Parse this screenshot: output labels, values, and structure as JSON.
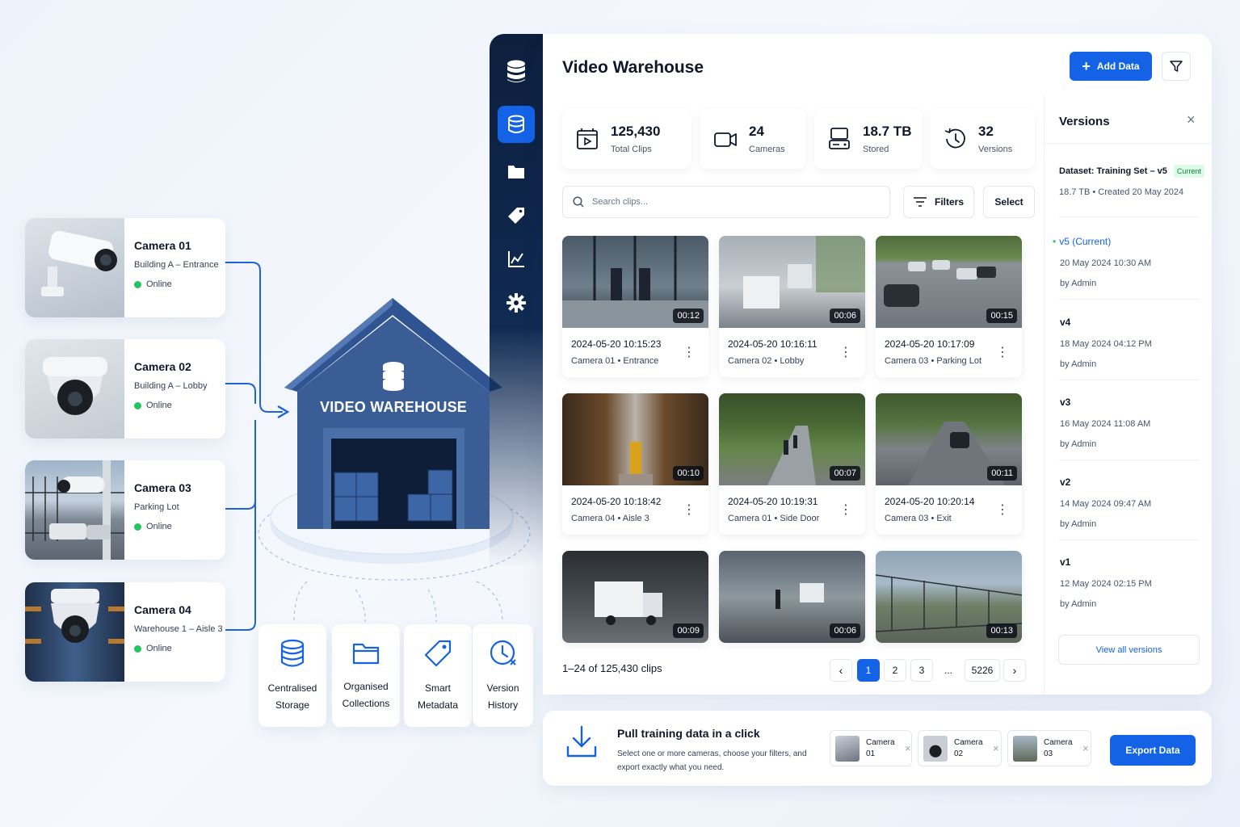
{
  "cameras": [
    {
      "name": "Camera 01",
      "location": "Building A – Entrance",
      "status": "Online"
    },
    {
      "name": "Camera 02",
      "location": "Building A – Lobby",
      "status": "Online"
    },
    {
      "name": "Camera 03",
      "location": "Parking Lot",
      "status": "Online"
    },
    {
      "name": "Camera 04",
      "location": "Warehouse 1 – Aisle 3",
      "status": "Online"
    }
  ],
  "warehouse_label": "VIDEO WAREHOUSE",
  "features": [
    {
      "line1": "Centralised",
      "line2": "Storage",
      "icon": "database-icon"
    },
    {
      "line1": "Organised",
      "line2": "Collections",
      "icon": "folder-icon"
    },
    {
      "line1": "Smart",
      "line2": "Metadata",
      "icon": "tag-icon"
    },
    {
      "line1": "Version",
      "line2": "History",
      "icon": "clock-icon"
    }
  ],
  "app": {
    "title": "Video Warehouse",
    "add_data_label": "Add Data",
    "stats": [
      {
        "value": "125,430",
        "caption": "Total Clips",
        "icon": "video-clip-icon"
      },
      {
        "value": "24",
        "caption": "Cameras",
        "icon": "camera-icon"
      },
      {
        "value": "18.7 TB",
        "caption": "Stored",
        "icon": "storage-icon"
      },
      {
        "value": "32",
        "caption": "Versions",
        "icon": "history-icon"
      }
    ],
    "search_placeholder": "Search clips...",
    "filters_label": "Filters",
    "select_label": "Select",
    "clips": [
      {
        "duration": "00:12",
        "timestamp": "2024-05-20 10:15:23",
        "source": "Camera 01 • Entrance"
      },
      {
        "duration": "00:06",
        "timestamp": "2024-05-20 10:16:11",
        "source": "Camera 02 • Lobby"
      },
      {
        "duration": "00:15",
        "timestamp": "2024-05-20 10:17:09",
        "source": "Camera 03 • Parking Lot"
      },
      {
        "duration": "00:10",
        "timestamp": "2024-05-20 10:18:42",
        "source": "Camera 04 • Aisle 3"
      },
      {
        "duration": "00:07",
        "timestamp": "2024-05-20 10:19:31",
        "source": "Camera 01 • Side Door"
      },
      {
        "duration": "00:11",
        "timestamp": "2024-05-20 10:20:14",
        "source": "Camera 03 • Exit"
      },
      {
        "duration": "00:09"
      },
      {
        "duration": "00:06"
      },
      {
        "duration": "00:13"
      }
    ],
    "pagination": {
      "summary": "1–24 of 125,430 clips",
      "pages": [
        "1",
        "2",
        "3",
        "...",
        "5226"
      ],
      "current": "1"
    },
    "versions": {
      "title": "Versions",
      "dataset": "Dataset: Training Set – v5",
      "dataset_badge": "Current",
      "dataset_meta": "18.7 TB • Created 20 May 2024",
      "items": [
        {
          "name": "v5 (Current)",
          "date": "20 May 2024 10:30 AM",
          "by": "by Admin"
        },
        {
          "name": "v4",
          "date": "18 May 2024 04:12 PM",
          "by": "by Admin"
        },
        {
          "name": "v3",
          "date": "16 May 2024 11:08 AM",
          "by": "by Admin"
        },
        {
          "name": "v2",
          "date": "14 May 2024 09:47 AM",
          "by": "by Admin"
        },
        {
          "name": "v1",
          "date": "12 May 2024 02:15 PM",
          "by": "by Admin"
        }
      ],
      "view_all_label": "View all versions"
    }
  },
  "export_bar": {
    "title": "Pull training data in a click",
    "description_line1": "Select one or more cameras, choose your filters, and",
    "description_line2": "export exactly what you need.",
    "chips": [
      {
        "line1": "Camera",
        "line2": "01"
      },
      {
        "line1": "Camera",
        "line2": "02"
      },
      {
        "line1": "Camera",
        "line2": "03"
      }
    ],
    "export_label": "Export Data"
  },
  "colors": {
    "accent": "#1463e6",
    "navy": "#0d1f3d",
    "online": "#22c55e",
    "warehouse": "#3a5d96"
  }
}
